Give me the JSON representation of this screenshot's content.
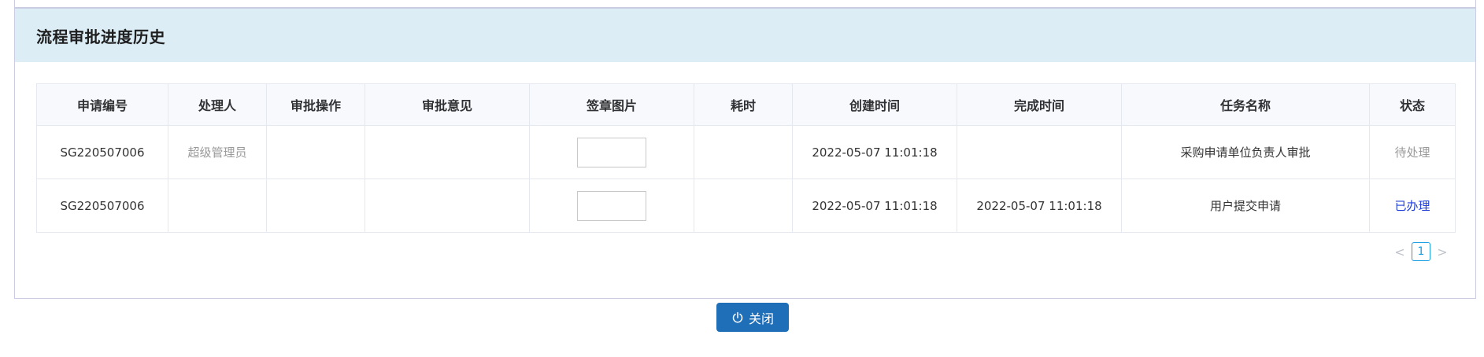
{
  "panel": {
    "title": "流程审批进度历史"
  },
  "table": {
    "columns": [
      "申请编号",
      "处理人",
      "审批操作",
      "审批意见",
      "签章图片",
      "耗时",
      "创建时间",
      "完成时间",
      "任务名称",
      "状态"
    ],
    "rows": [
      {
        "app_no": "SG220507006",
        "handler": "超级管理员",
        "operation": "",
        "opinion": "",
        "duration": "",
        "created": "2022-05-07 11:01:18",
        "completed": "",
        "task": "采购申请单位负责人审批",
        "status": "待处理"
      },
      {
        "app_no": "SG220507006",
        "handler": "",
        "operation": "",
        "opinion": "",
        "duration": "",
        "created": "2022-05-07 11:01:18",
        "completed": "2022-05-07 11:01:18",
        "task": "用户提交申请",
        "status": "已办理"
      }
    ]
  },
  "pagination": {
    "prev": "<",
    "current": "1",
    "next": ">"
  },
  "footer": {
    "close_label": "关闭"
  },
  "colors": {
    "header_bg": "#dcedf6",
    "button_bg": "#1f6fb8",
    "done_status": "#1f3fd6",
    "pager_accent": "#1aa0e3"
  },
  "icons": {
    "close_button_icon": "power-icon"
  }
}
